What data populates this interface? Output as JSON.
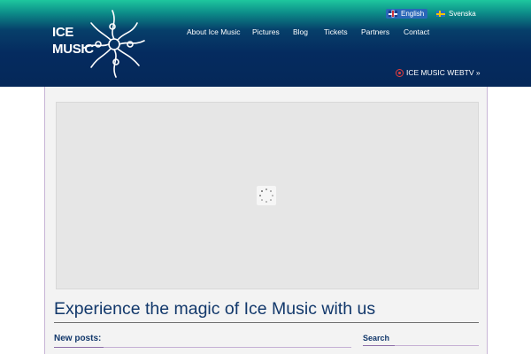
{
  "brand": {
    "logo_line1": "ICE",
    "logo_line2": "MUSIC"
  },
  "languages": [
    {
      "label": "English",
      "flag": "uk-flag-icon",
      "active": true
    },
    {
      "label": "Svenska",
      "flag": "sweden-flag-icon",
      "active": false
    }
  ],
  "nav": {
    "items": [
      "About Ice Music",
      "Pictures",
      "Blog",
      "Tickets",
      "Partners",
      "Contact"
    ]
  },
  "webtv": {
    "label": "ICE MUSIC WEBTV »",
    "icon": "record-icon"
  },
  "hero": {
    "loading_icon": "spinner-icon"
  },
  "content": {
    "tagline": "Experience the magic of Ice Music with us",
    "new_posts_heading": "New posts:",
    "search_heading": "Search"
  },
  "colors": {
    "header_top": "#1ec79e",
    "header_bottom": "#052859",
    "heading_text": "#12386b",
    "accent_rule": "#8d6fa9"
  }
}
